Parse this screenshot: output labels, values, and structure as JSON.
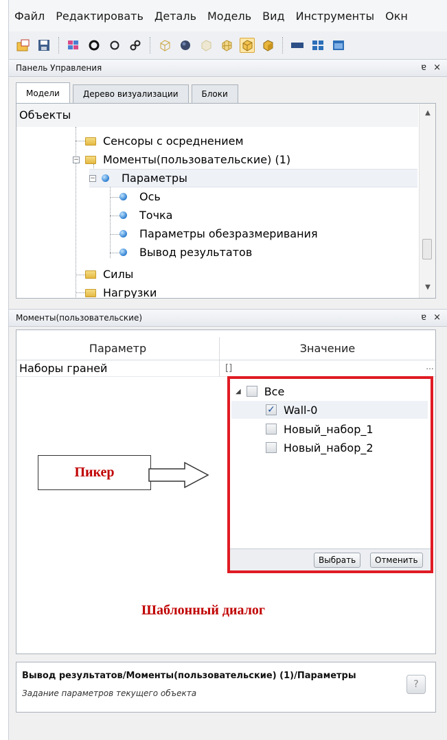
{
  "menu": [
    "Файл",
    "Редактировать",
    "Деталь",
    "Модель",
    "Вид",
    "Инструменты",
    "Окн"
  ],
  "toolbar": {
    "buttons": [
      {
        "name": "new-model-icon"
      },
      {
        "name": "save-icon"
      },
      {
        "name": "sep"
      },
      {
        "name": "mesh-icon"
      },
      {
        "name": "circle-filled-icon"
      },
      {
        "name": "circle-outline-icon"
      },
      {
        "name": "link-icon"
      },
      {
        "name": "sep"
      },
      {
        "name": "cube-wireframe-icon"
      },
      {
        "name": "sphere-icon"
      },
      {
        "name": "cube-faded-icon"
      },
      {
        "name": "cube-grid-icon"
      },
      {
        "name": "cube-solid-icon",
        "active": true
      },
      {
        "name": "cube-shaded-icon"
      },
      {
        "name": "sep"
      },
      {
        "name": "panel-icon"
      },
      {
        "name": "layout-icon"
      },
      {
        "name": "window-icon"
      }
    ]
  },
  "control_panel": {
    "title": "Панель Управления",
    "pin": "ɐ",
    "close": "×",
    "tabs": [
      "Модели",
      "Дерево визуализации",
      "Блоки"
    ],
    "tree": {
      "header": "Объекты",
      "items": [
        {
          "label": "Сенсоры с осреднением",
          "icon": "folder-icon"
        },
        {
          "label": "Моменты(пользовательские) (1)",
          "icon": "folder-icon",
          "expander": "−"
        },
        {
          "label": "Параметры",
          "icon": "node-icon",
          "expander": "−",
          "selected": true
        },
        {
          "label": "Ось",
          "icon": "node-icon"
        },
        {
          "label": "Точка",
          "icon": "node-icon"
        },
        {
          "label": "Параметры обезразмеривания",
          "icon": "node-icon"
        },
        {
          "label": "Вывод результатов",
          "icon": "node-icon"
        },
        {
          "label": "Силы",
          "icon": "folder-icon"
        },
        {
          "label": "Нагрузки",
          "icon": "folder-icon"
        }
      ]
    }
  },
  "properties_panel": {
    "title": "Моменты(пользовательские)",
    "pin": "ɐ",
    "close": "×",
    "columns": [
      "Параметр",
      "Значение"
    ],
    "rows": [
      {
        "param": "Наборы граней",
        "value": "[]",
        "button": "..."
      }
    ]
  },
  "picker": {
    "root": "Все",
    "items": [
      {
        "label": "Wall-0",
        "checked": true
      },
      {
        "label": "Новый_набор_1",
        "checked": false
      },
      {
        "label": "Новый_набор_2",
        "checked": false
      }
    ],
    "ok_label": "Выбрать",
    "cancel_label": "Отменить"
  },
  "annotations": {
    "picker_label": "Пикер",
    "dialog_caption": "Шаблонный диалог",
    "accent_color": "#c00000",
    "frame_color": "#e01b24"
  },
  "help": {
    "title": "Вывод результатов/Моменты(пользовательские) (1)/Параметры",
    "description": "Задание параметров текущего объекта",
    "icon": "?"
  }
}
